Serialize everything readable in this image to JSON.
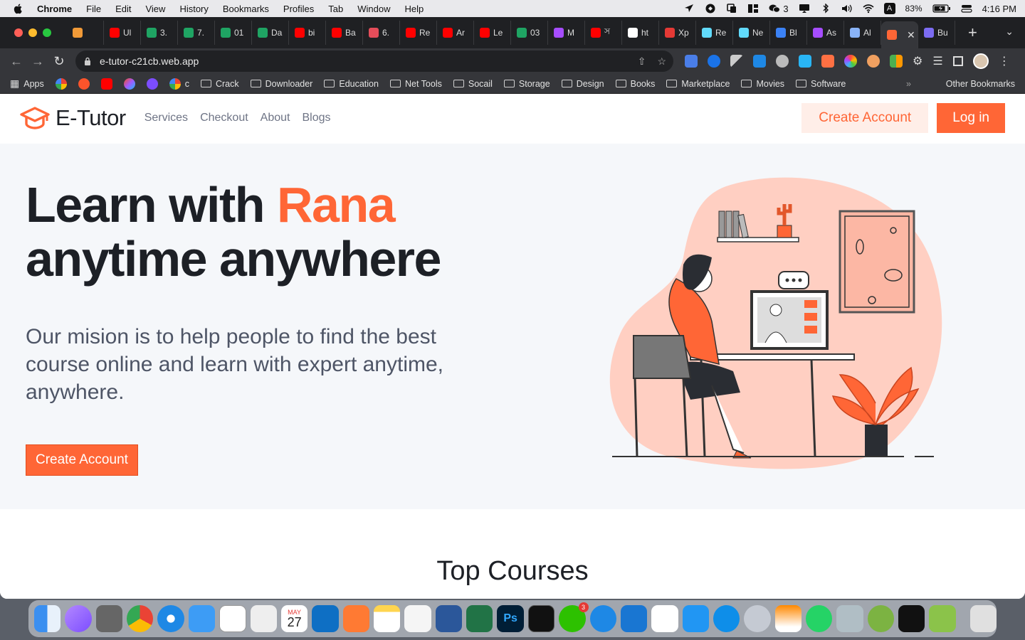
{
  "menubar": {
    "app_name": "Chrome",
    "items": [
      "File",
      "Edit",
      "View",
      "History",
      "Bookmarks",
      "Profiles",
      "Tab",
      "Window",
      "Help"
    ],
    "wechat_count": "3",
    "input_source": "A",
    "battery": "83%",
    "clock": "4:16 PM"
  },
  "tabs": [
    {
      "label": "",
      "color": "#f19a38"
    },
    {
      "label": "Ul",
      "color": "#ff0000"
    },
    {
      "label": "3.",
      "color": "#1fa463"
    },
    {
      "label": "7.",
      "color": "#1fa463"
    },
    {
      "label": "01",
      "color": "#1fa463"
    },
    {
      "label": "Da",
      "color": "#1fa463"
    },
    {
      "label": "bi",
      "color": "#ff0000"
    },
    {
      "label": "Ba",
      "color": "#ff0000"
    },
    {
      "label": "6.",
      "color": "#e44d5a"
    },
    {
      "label": "Re",
      "color": "#ff0000"
    },
    {
      "label": "Ar",
      "color": "#ff0000"
    },
    {
      "label": "Le",
      "color": "#ff0000"
    },
    {
      "label": "03",
      "color": "#1fa463"
    },
    {
      "label": "M",
      "color": "#a64dff"
    },
    {
      "label": "স",
      "color": "#ff0000"
    },
    {
      "label": "ht",
      "color": "#ffffff"
    },
    {
      "label": "Xp",
      "color": "#e53935"
    },
    {
      "label": "Re",
      "color": "#61dafb"
    },
    {
      "label": "Ne",
      "color": "#61dafb"
    },
    {
      "label": "Bl",
      "color": "#3b82f6"
    },
    {
      "label": "As",
      "color": "#a64dff"
    },
    {
      "label": "Al",
      "color": "#8ab4f8"
    },
    {
      "label": "",
      "color": "#ff6636",
      "active": true
    },
    {
      "label": "Bu",
      "color": "#7c6cf2"
    }
  ],
  "omnibox": {
    "url": "e-tutor-c21cb.web.app"
  },
  "bookmarks": {
    "apps_label": "Apps",
    "items": [
      {
        "label": "c",
        "type": "site"
      },
      {
        "label": "Crack",
        "type": "folder"
      },
      {
        "label": "Downloader",
        "type": "folder"
      },
      {
        "label": "Education",
        "type": "folder"
      },
      {
        "label": "Net Tools",
        "type": "folder"
      },
      {
        "label": "Socail",
        "type": "folder"
      },
      {
        "label": "Storage",
        "type": "folder"
      },
      {
        "label": "Design",
        "type": "folder"
      },
      {
        "label": "Books",
        "type": "folder"
      },
      {
        "label": "Marketplace",
        "type": "folder"
      },
      {
        "label": "Movies",
        "type": "folder"
      },
      {
        "label": "Software",
        "type": "folder"
      }
    ],
    "more_label": "»",
    "other_label": "Other Bookmarks"
  },
  "site": {
    "logo_text": "E-Tutor",
    "nav": [
      "Services",
      "Checkout",
      "About",
      "Blogs"
    ],
    "create_account_label": "Create Account",
    "login_label": "Log in",
    "hero": {
      "title_part1": "Learn with ",
      "title_accent": "Rana",
      "title_line2": "anytime anywhere",
      "subtitle": "Our mision is to help people to find the best course online and learn with expert anytime, anywhere.",
      "cta_label": "Create Account"
    },
    "section_title": "Top Courses",
    "brand_color": "#ff6636"
  },
  "dock": {
    "calendar_month": "MAY",
    "calendar_day": "27",
    "wechat_badge": "3"
  }
}
